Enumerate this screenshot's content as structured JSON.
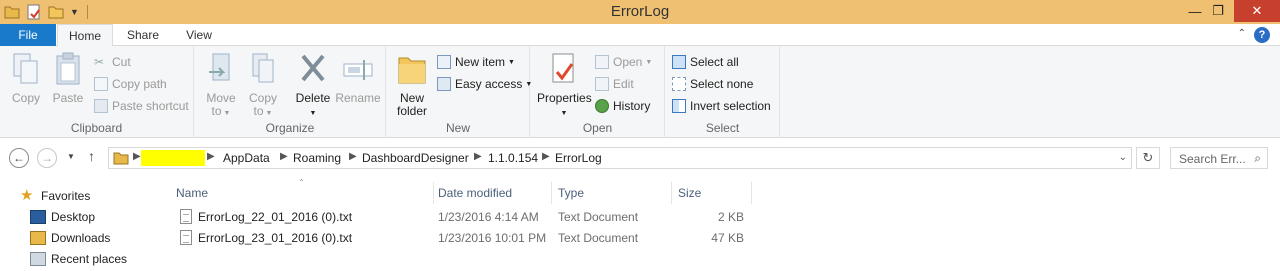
{
  "window": {
    "title": "ErrorLog"
  },
  "ribbon": {
    "tabs": {
      "file": "File",
      "home": "Home",
      "share": "Share",
      "view": "View"
    },
    "clipboard": {
      "label": "Clipboard",
      "copy": "Copy",
      "paste": "Paste",
      "cut": "Cut",
      "copy_path": "Copy path",
      "paste_shortcut": "Paste shortcut"
    },
    "organize": {
      "label": "Organize",
      "move_to": [
        "Move",
        "to"
      ],
      "copy_to": [
        "Copy",
        "to"
      ],
      "delete": "Delete",
      "rename": "Rename"
    },
    "new": {
      "label": "New",
      "new_folder": [
        "New",
        "folder"
      ],
      "new_item": "New item",
      "easy_access": "Easy access"
    },
    "open": {
      "label": "Open",
      "properties": "Properties",
      "open": "Open",
      "edit": "Edit",
      "history": "History"
    },
    "select": {
      "label": "Select",
      "select_all": "Select all",
      "select_none": "Select none",
      "invert_selection": "Invert selection"
    }
  },
  "address": {
    "breadcrumbs": [
      "AppData",
      "Roaming",
      "DashboardDesigner",
      "1.1.0.154",
      "ErrorLog"
    ],
    "search_placeholder": "Search Err..."
  },
  "nav_pane": {
    "favorites": "Favorites",
    "items": [
      "Desktop",
      "Downloads",
      "Recent places"
    ]
  },
  "files": {
    "columns": {
      "name": "Name",
      "date": "Date modified",
      "type": "Type",
      "size": "Size"
    },
    "rows": [
      {
        "name": "ErrorLog_22_01_2016 (0).txt",
        "date": "1/23/2016 4:14 AM",
        "type": "Text Document",
        "size": "2 KB"
      },
      {
        "name": "ErrorLog_23_01_2016 (0).txt",
        "date": "1/23/2016 10:01 PM",
        "type": "Text Document",
        "size": "47 KB"
      }
    ]
  },
  "colors": {
    "titlebar": "#f0c072",
    "file_tab": "#1979ca",
    "close_button": "#c7402d",
    "redaction": "#ffff00"
  }
}
